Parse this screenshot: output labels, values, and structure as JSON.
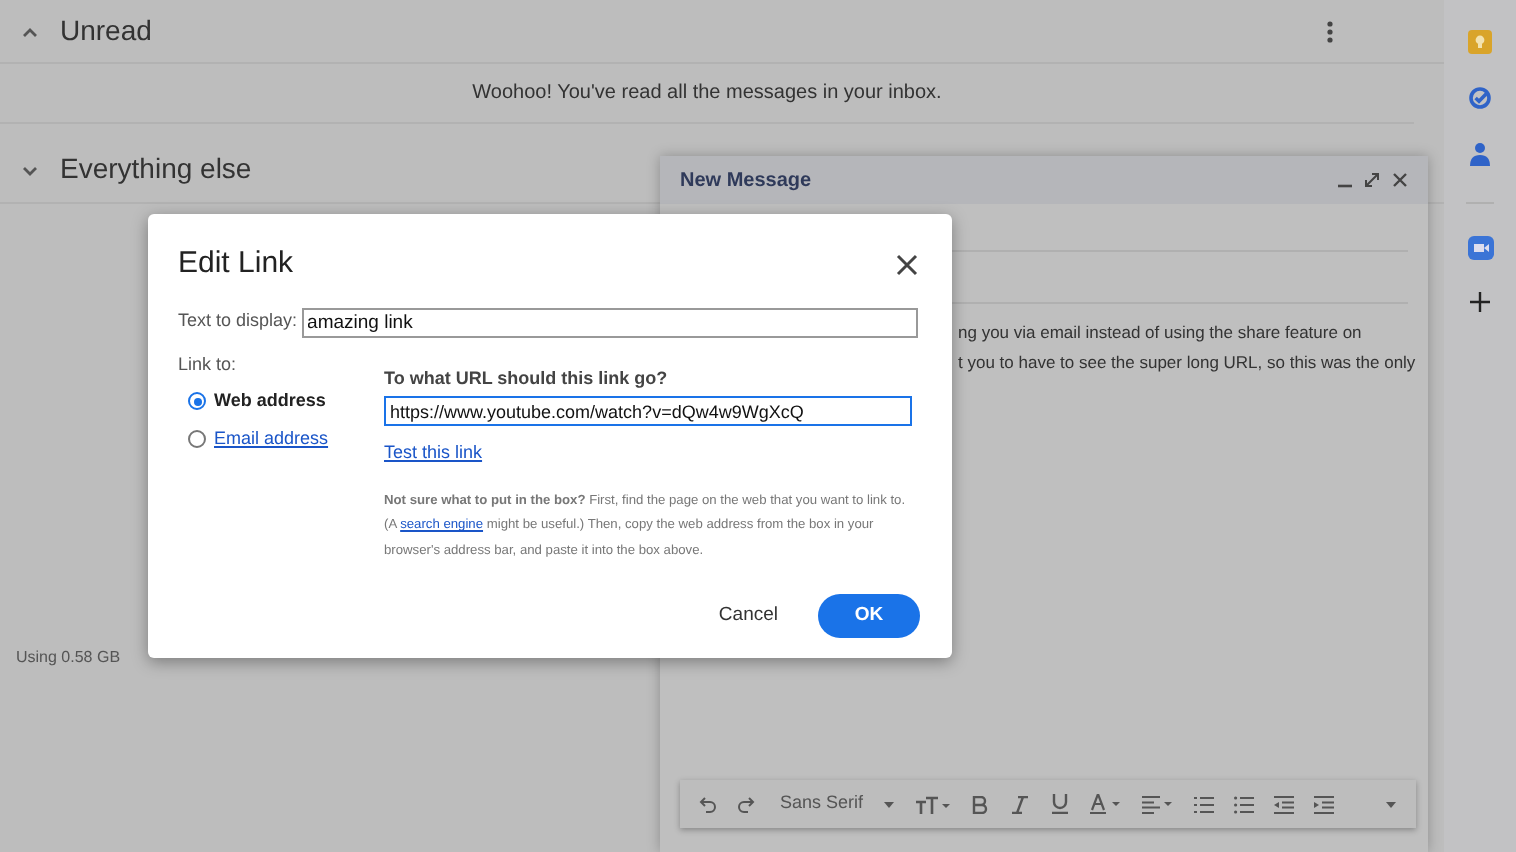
{
  "sections": [
    {
      "title": "Unread",
      "expanded": true,
      "message": "Woohoo! You've read all the messages in your inbox."
    },
    {
      "title": "Everything else",
      "expanded": false
    }
  ],
  "storage": "Using 0.58 GB",
  "compose": {
    "title": "New Message",
    "body_lines": [
      "ng you via email instead of using the share feature on",
      "t you to have to see the super long URL, so this was the only"
    ],
    "font": "Sans Serif"
  },
  "dialog": {
    "title": "Edit Link",
    "text_label": "Text to display:",
    "text_value": "amazing link",
    "link_to_label": "Link to:",
    "options": [
      {
        "label": "Web address",
        "selected": true
      },
      {
        "label": "Email address",
        "selected": false
      }
    ],
    "url_question": "To what URL should this link go?",
    "url_value": "https://www.youtube.com/watch?v=dQw4w9WgXcQ",
    "test_link": "Test this link",
    "help": {
      "before": "**Not sure what to put in the box?** First, find the page on the web that you want to link to. (A",
      "link": "search engine",
      "after": "might be useful.) Then, copy the web address from the box in your browser's address bar, and paste it into the box above."
    },
    "buttons": {
      "cancel": "Cancel",
      "ok": "OK"
    }
  }
}
